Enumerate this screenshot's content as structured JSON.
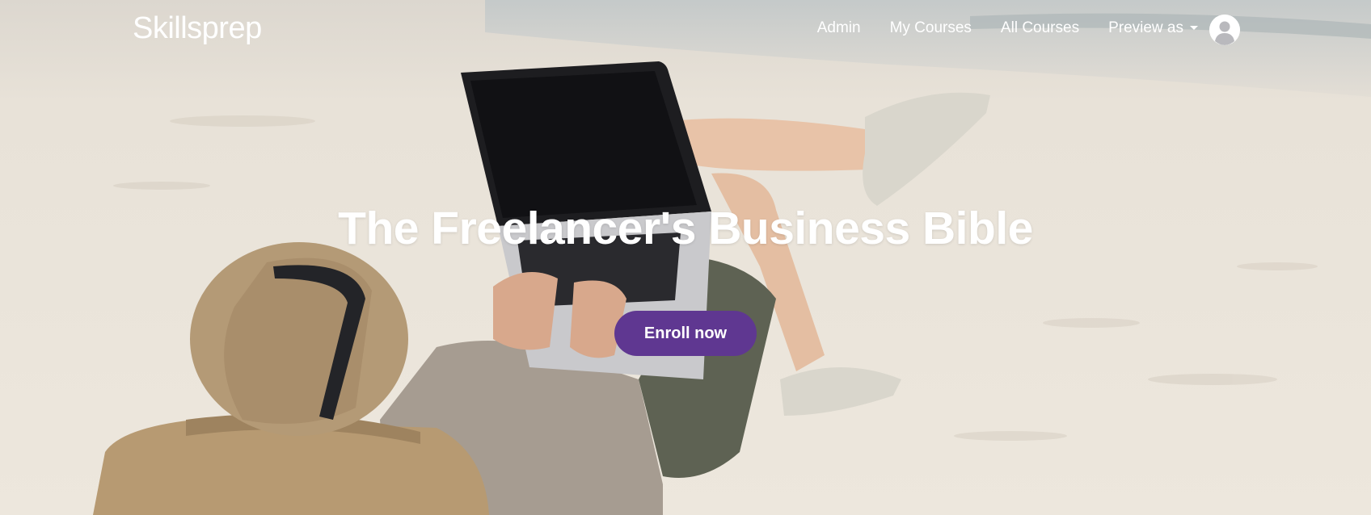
{
  "navbar": {
    "brand": "Skillsprep",
    "links": [
      {
        "label": "Admin"
      },
      {
        "label": "My Courses"
      },
      {
        "label": "All Courses"
      },
      {
        "label": "Preview as"
      }
    ],
    "avatar_icon": "user-avatar-icon"
  },
  "hero": {
    "title": "The Freelancer's Business Bible",
    "cta_label": "Enroll now",
    "background": "photo of a person in a straw hat lying on a beach with a laptop"
  },
  "colors": {
    "cta": "#5f3791",
    "text": "#ffffff"
  }
}
